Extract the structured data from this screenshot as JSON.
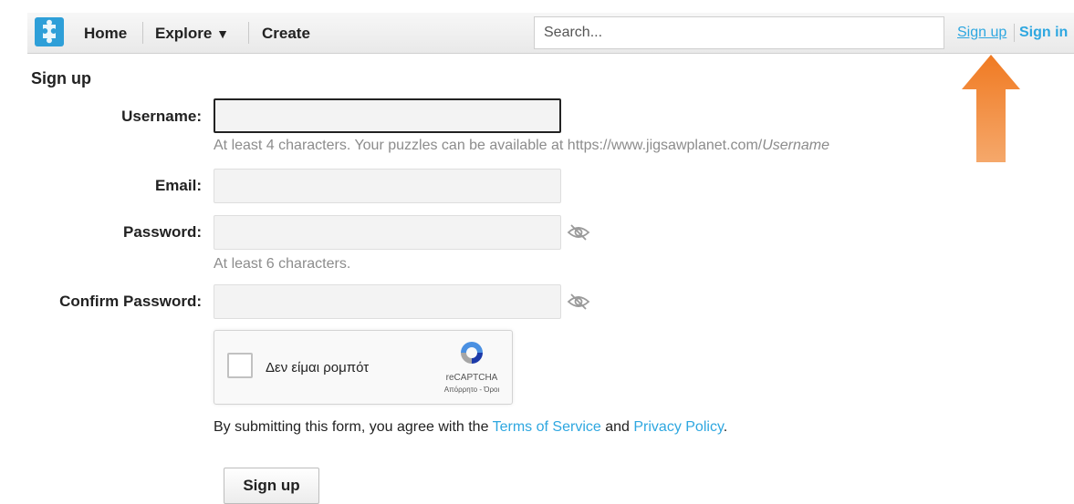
{
  "nav": {
    "home": "Home",
    "explore": "Explore",
    "explore_caret": "▼",
    "create": "Create",
    "search_placeholder": "Search...",
    "signup": "Sign up",
    "signin": "Sign in"
  },
  "form": {
    "heading": "Sign up",
    "username_label": "Username:",
    "username_value": "",
    "username_hint_prefix": "At least 4 characters. Your puzzles can be available at https://www.jigsawplanet.com/",
    "username_hint_italic": "Username",
    "email_label": "Email:",
    "email_value": "",
    "password_label": "Password:",
    "password_value": "",
    "password_hint": "At least 6 characters.",
    "confirm_label": "Confirm Password:",
    "confirm_value": "",
    "captcha_text": "Δεν είμαι ρομπότ",
    "captcha_brand": "reCAPTCHA",
    "captcha_terms": "Απόρρητο - Όροι",
    "agree_prefix": "By submitting this form, you agree with the ",
    "terms_link": "Terms of Service",
    "agree_and": " and ",
    "privacy_link": "Privacy Policy",
    "agree_suffix": ".",
    "submit_label": "Sign up"
  },
  "colors": {
    "link": "#2ea7e0",
    "arrow": "#f07a22",
    "logo": "#2e9fd8"
  },
  "icons": [
    "puzzle-logo-icon",
    "eye-off-icon",
    "recaptcha-logo-icon",
    "arrow-up-icon"
  ]
}
